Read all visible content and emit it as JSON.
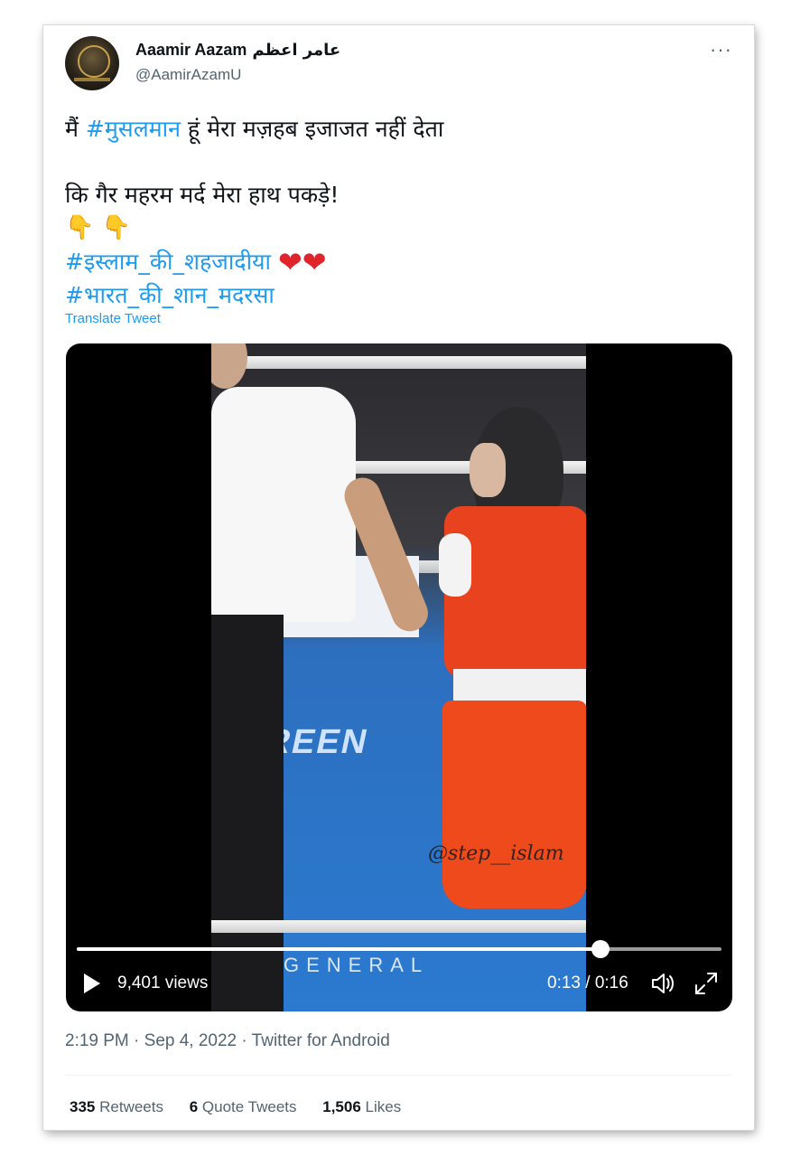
{
  "user": {
    "display_name": "Aaamir Aazam",
    "display_name_arabic": "عامر اعظم",
    "handle": "@AamirAzamU",
    "avatar": "avatar-icon"
  },
  "more_icon": "more-dots-icon",
  "tweet": {
    "line1_pre": "मैं ",
    "line1_tag": "#मुसलमान",
    "line1_post": " हूं मेरा मज़हब इजाजत नहीं देता",
    "line2": "कि गैर महरम मर्द मेरा हाथ पकड़े!",
    "emoji_point": "👇 👇",
    "tag2": "#इस्लाम_की_शहजादीया",
    "hearts": "❤❤",
    "tag3": "#भारत_की_शान_मदरसा",
    "translate": "Translate Tweet"
  },
  "video": {
    "views": "9,401 views",
    "time": "0:13 / 0:16",
    "progress_fraction": 0.8125,
    "watermark": "@step__islam",
    "play_icon": "play-icon",
    "volume_icon": "volume-icon",
    "fullscreen_icon": "expand-icon"
  },
  "meta": {
    "timestamp": "2:19 PM · Sep 4, 2022 · Twitter for Android"
  },
  "stats": {
    "retweets_count": "335",
    "retweets_label": "Retweets",
    "quotes_count": "6",
    "quotes_label": "Quote Tweets",
    "likes_count": "1,506",
    "likes_label": "Likes"
  },
  "colors": {
    "link": "#1d9bf0",
    "secondary_text": "#536471",
    "heart": "#e0242c"
  }
}
